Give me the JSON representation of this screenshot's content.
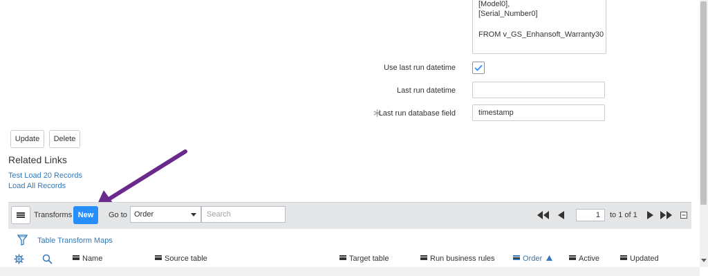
{
  "form": {
    "sql_lines": [
      "[Model0],",
      "[Serial_Number0]",
      "FROM v_GS_Enhansoft_Warranty30"
    ],
    "use_last_run_label": "Use last run datetime",
    "use_last_run_checked": true,
    "last_run_label": "Last run datetime",
    "last_run_value": "",
    "last_run_db_field_label": "Last run database field",
    "last_run_db_field_value": "timestamp",
    "update_label": "Update",
    "delete_label": "Delete"
  },
  "related": {
    "title": "Related Links",
    "links": [
      "Test Load 20 Records",
      "Load All Records"
    ]
  },
  "list": {
    "title": "Transforms",
    "new_label": "New",
    "goto_label": "Go to",
    "goto_selected": "Order",
    "search_placeholder": "Search",
    "page_current": "1",
    "page_of": "to 1 of 1",
    "breadcrumb": "Table Transform Maps",
    "columns": [
      "Name",
      "Source table",
      "Target table",
      "Run business rules",
      "Order",
      "Active",
      "Updated"
    ],
    "sorted_column": "Order",
    "accent_color": "#278efc",
    "link_color": "#3278b8"
  },
  "icons": [
    "gear-icon",
    "search-icon",
    "filter-icon",
    "first-page-icon",
    "prev-page-icon",
    "next-page-icon",
    "last-page-icon",
    "collapse-icon",
    "required-asterisk-icon",
    "checkmark-icon"
  ]
}
